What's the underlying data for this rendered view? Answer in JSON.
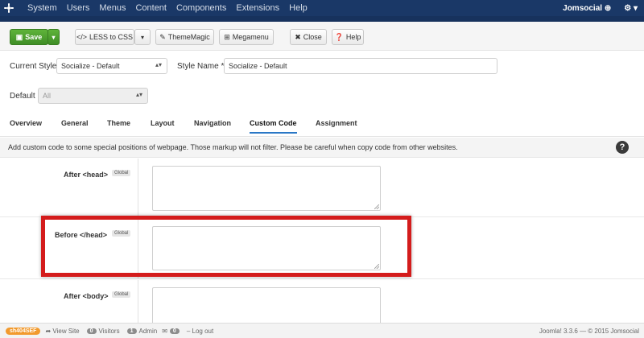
{
  "topnav": {
    "logo_icon": "joomla-logo-icon",
    "menu": [
      "System",
      "Users",
      "Menus",
      "Content",
      "Components",
      "Extensions",
      "Help"
    ],
    "user": "Jomsocial",
    "settings_icon": "gear-icon"
  },
  "toolbar": {
    "save": "Save",
    "less_to_css": "LESS to CSS",
    "thememagic": "ThemeMagic",
    "megamenu": "Megamenu",
    "close": "Close",
    "help": "Help"
  },
  "style": {
    "current_style_label": "Current Style",
    "current_style_value": "Socialize - Default",
    "style_name_label": "Style Name",
    "required_mark": "*",
    "style_name_value": "Socialize - Default",
    "default_label": "Default",
    "default_value": "All"
  },
  "tabs": [
    "Overview",
    "General",
    "Theme",
    "Layout",
    "Navigation",
    "Custom Code",
    "Assignment"
  ],
  "active_tab": "Custom Code",
  "info": {
    "text": "Add custom code to some special positions of webpage. Those markup will not filter. Please be careful when copy code from other websites.",
    "help_symbol": "?"
  },
  "fields": [
    {
      "label": "After <head>",
      "badge": "Global"
    },
    {
      "label": "Before </head>",
      "badge": "Global"
    },
    {
      "label": "After <body>",
      "badge": "Global"
    }
  ],
  "status": {
    "sef": "sh404SEF",
    "view_site": "View Site",
    "visitors_count": "0",
    "visitors_label": "Visitors",
    "admin_count": "1",
    "admin_label": "Admin",
    "messages_count": "0",
    "logout": "Log out",
    "version": "Joomla! 3.3.6 — © 2015 Jomsocial"
  },
  "colors": {
    "nav_bg": "#1a3867",
    "save_green": "#46992b",
    "highlight_red": "#d41c1c",
    "tab_active": "#2a78c6",
    "sef_orange": "#f29a2e"
  }
}
